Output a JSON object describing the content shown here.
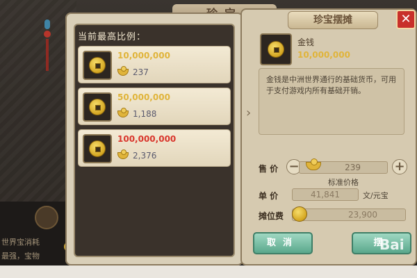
{
  "back_panel": {
    "title": "珍宝"
  },
  "background": {
    "line1": "世界宝消耗",
    "line2": "最强，宝物"
  },
  "left_panel": {
    "header": "当前最高比例：",
    "offers": [
      {
        "amount": "10,000,000",
        "amount_color": "#e0b43a",
        "gold": "237"
      },
      {
        "amount": "50,000,000",
        "amount_color": "#e0b43a",
        "gold": "1,188"
      },
      {
        "amount": "100,000,000",
        "amount_color": "#d9362c",
        "gold": "2,376"
      }
    ]
  },
  "right_panel": {
    "title": "珍宝摆摊",
    "close_label": "✕",
    "item": {
      "name": "金钱",
      "amount": "10,000,000",
      "description": "金钱是中洲世界通行的基础货币，可用于支付游戏内所有基础开销。"
    },
    "side_arrow": "›",
    "price": {
      "label": "售 价",
      "value": "239",
      "minus": "−",
      "plus": "+"
    },
    "standard_price_label": "标准价格",
    "unit_price": {
      "label": "单 价",
      "value": "41,841",
      "unit": "文/元宝"
    },
    "fee": {
      "label": "摊位费",
      "value": "23,900"
    },
    "cancel_label": "取消",
    "confirm_label": "摆"
  },
  "watermark": "Bai"
}
